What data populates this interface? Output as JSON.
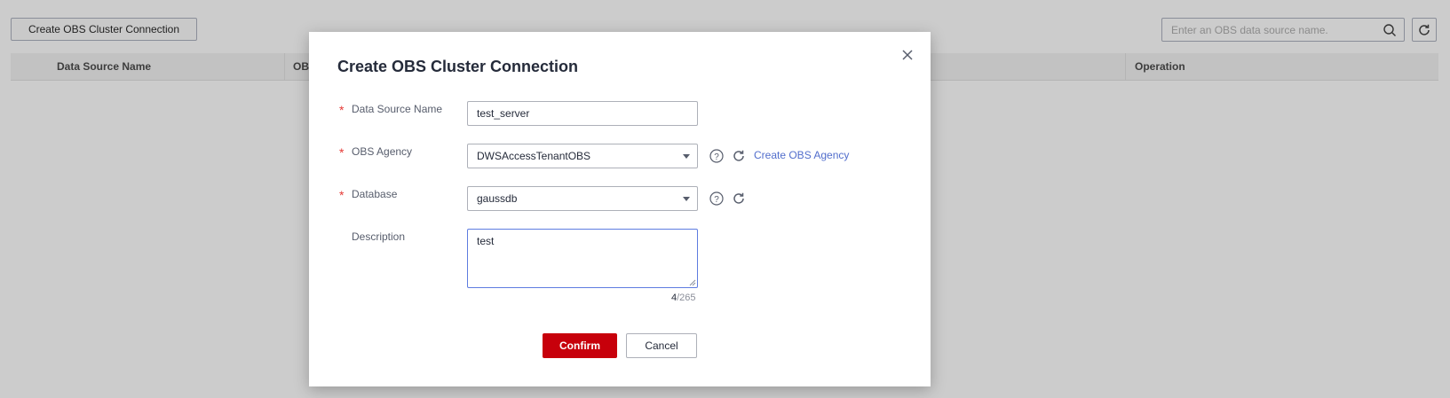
{
  "background": {
    "create_button_label": "Create OBS Cluster Connection",
    "search_placeholder": "Enter an OBS data source name.",
    "table_headers": {
      "data_source_name": "Data Source Name",
      "obs_partial": "OB",
      "operation": "Operation"
    }
  },
  "modal": {
    "title": "Create OBS Cluster Connection",
    "required_mark": "*",
    "fields": {
      "data_source_name": {
        "label": "Data Source Name",
        "value": "test_server"
      },
      "obs_agency": {
        "label": "OBS Agency",
        "value": "DWSAccessTenantOBS",
        "create_link": "Create OBS Agency"
      },
      "database": {
        "label": "Database",
        "value": "gaussdb"
      },
      "description": {
        "label": "Description",
        "value": "test",
        "count": "4",
        "max": "/265"
      }
    },
    "confirm_label": "Confirm",
    "cancel_label": "Cancel"
  },
  "colors": {
    "primary": "#c7000b",
    "link": "#526ecc",
    "required": "#e53935"
  }
}
